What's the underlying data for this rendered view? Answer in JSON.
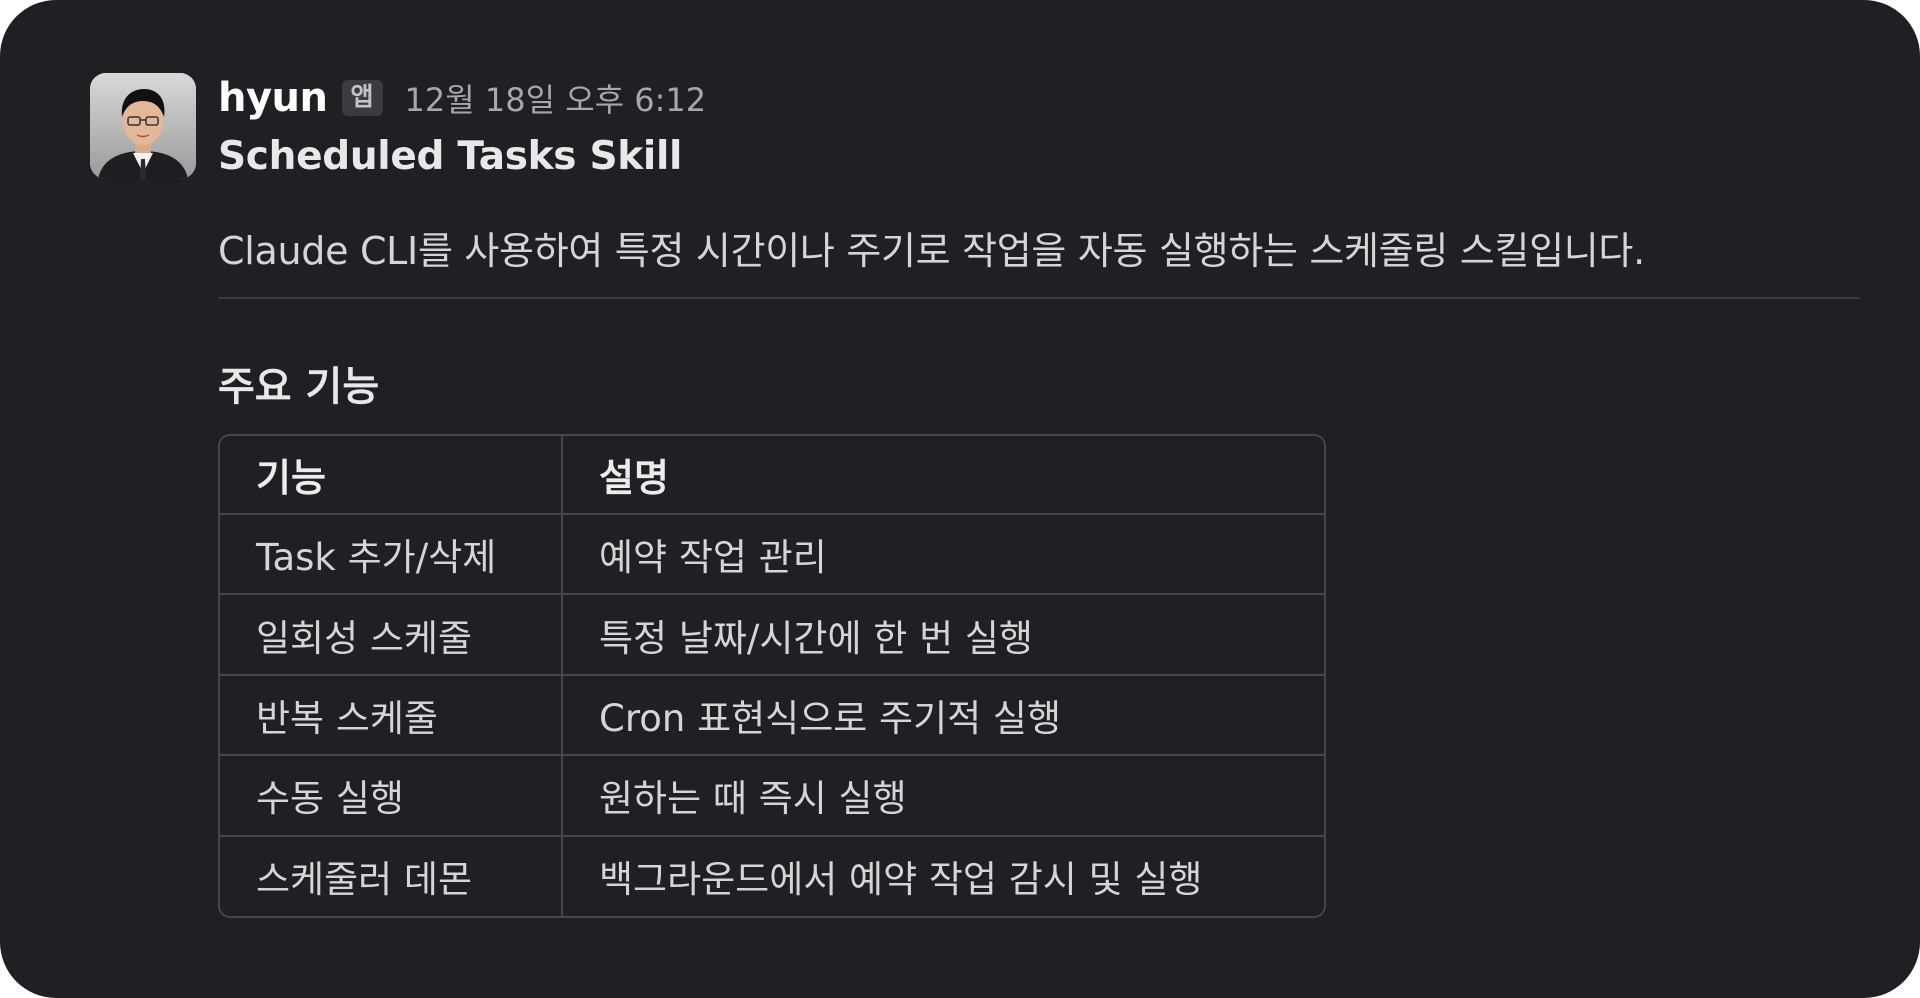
{
  "message": {
    "username": "hyun",
    "badge": "앱",
    "timestamp": "12월 18일 오후 6:12",
    "title": "Scheduled Tasks Skill",
    "description": "Claude CLI를 사용하여 특정 시간이나 주기로 작업을 자동 실행하는 스케줄링 스킬입니다.",
    "section_heading": "주요 기능",
    "table": {
      "headers": [
        "기능",
        "설명"
      ],
      "rows": [
        [
          "Task 추가/삭제",
          "예약 작업 관리"
        ],
        [
          "일회성 스케줄",
          "특정 날짜/시간에 한 번 실행"
        ],
        [
          "반복 스케줄",
          "Cron 표현식으로 주기적 실행"
        ],
        [
          "수동 실행",
          "원하는 때 즉시 실행"
        ],
        [
          "스케줄러 데몬",
          "백그라운드에서 예약 작업 감시 및 실행"
        ]
      ]
    }
  },
  "colors": {
    "background": "#1f2023",
    "text_primary": "#ffffff",
    "text_secondary": "#a6a7ab",
    "border": "#45464a"
  }
}
